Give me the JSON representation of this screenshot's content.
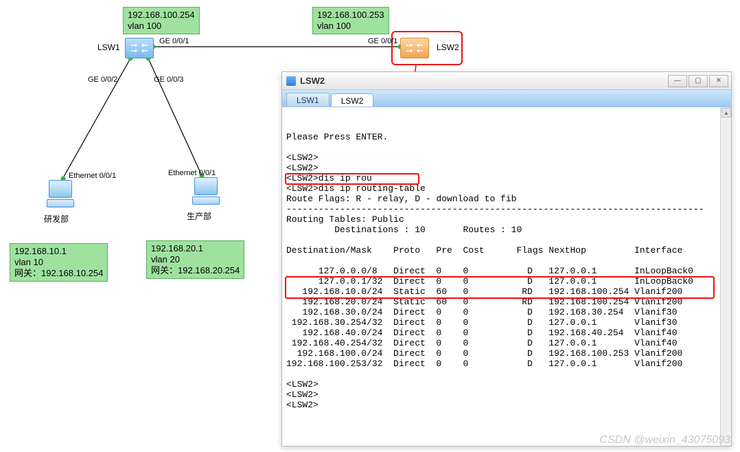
{
  "topology": {
    "lsw1": {
      "label": "LSW1",
      "ip_label": "192.168.100.254\nvlan 100"
    },
    "lsw2": {
      "label": "LSW2",
      "ip_label": "192.168.100.253\nvlan 100"
    },
    "pc1": {
      "label": "研发部",
      "if_label": "Ethernet 0/0/1",
      "info": "192.168.10.1\nvlan 10\n网关：192.168.10.254"
    },
    "pc2": {
      "label": "生产部",
      "if_label": "Ethernet 0/0/1",
      "info": "192.168.20.1\nvlan 20\n网关：192.168.20.254"
    },
    "links": {
      "lsw1_lsw2_a": "GE 0/0/1",
      "lsw1_lsw2_b": "GE 0/0/1",
      "lsw1_pc1": "GE 0/0/2",
      "lsw1_pc2": "GE 0/0/3"
    }
  },
  "window": {
    "title": "LSW2",
    "tabs": [
      "LSW1",
      "LSW2"
    ],
    "active_tab": 1,
    "btn_min": "—",
    "btn_max": "▢",
    "btn_close": "✕"
  },
  "terminal": {
    "lines": [
      "",
      "Please Press ENTER.",
      "",
      "<LSW2>",
      "<LSW2>",
      "<LSW2>dis ip rou",
      "<LSW2>dis ip routing-table",
      "Route Flags: R - relay, D - download to fib",
      "------------------------------------------------------------------------------",
      "Routing Tables: Public",
      "         Destinations : 10       Routes : 10",
      "",
      "Destination/Mask    Proto   Pre  Cost      Flags NextHop         Interface",
      "",
      "      127.0.0.0/8   Direct  0    0           D   127.0.0.1       InLoopBack0",
      "      127.0.0.1/32  Direct  0    0           D   127.0.0.1       InLoopBack0",
      "   192.168.10.0/24  Static  60   0          RD   192.168.100.254 Vlanif200",
      "   192.168.20.0/24  Static  60   0          RD   192.168.100.254 Vlanif200",
      "   192.168.30.0/24  Direct  0    0           D   192.168.30.254  Vlanif30",
      " 192.168.30.254/32  Direct  0    0           D   127.0.0.1       Vlanif30",
      "   192.168.40.0/24  Direct  0    0           D   192.168.40.254  Vlanif40",
      " 192.168.40.254/32  Direct  0    0           D   127.0.0.1       Vlanif40",
      "  192.168.100.0/24  Direct  0    0           D   192.168.100.253 Vlanif200",
      "192.168.100.253/32  Direct  0    0           D   127.0.0.1       Vlanif200",
      "",
      "<LSW2>",
      "<LSW2>",
      "<LSW2>"
    ],
    "highlight_line": 6,
    "highlight_rows_start": 16,
    "highlight_rows_end": 17
  },
  "watermark": "CSDN @weixin_43075093"
}
